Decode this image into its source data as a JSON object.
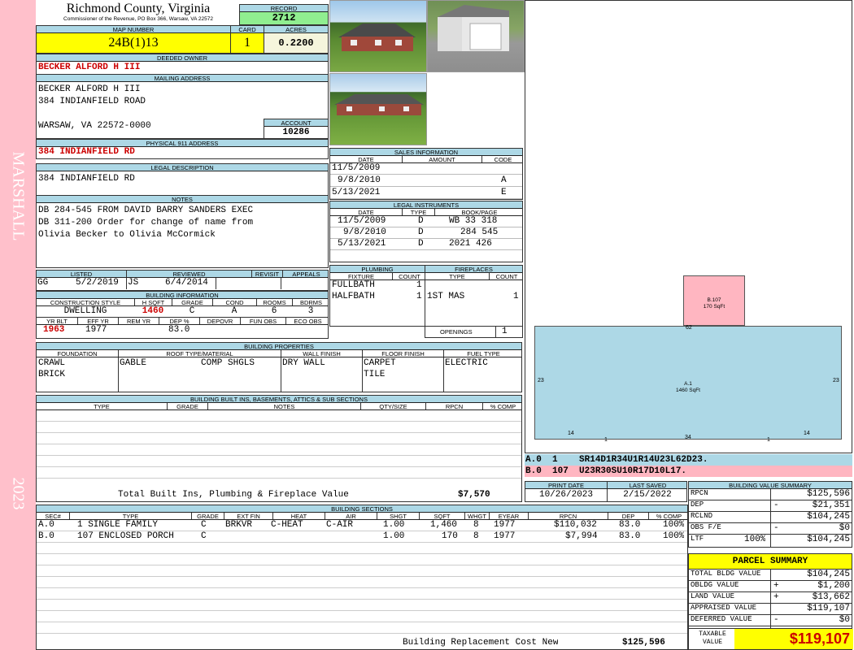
{
  "sidebar": {
    "district": "MARSHALL",
    "year": "2023"
  },
  "header": {
    "county": "Richmond County, Virginia",
    "commissioner": "Commissioner of the Revenue, PO Box 366, Warsaw, VA 22572",
    "record_label": "RECORD",
    "record": "2712",
    "map_label": "MAP NUMBER",
    "map_number": "24B(1)13",
    "card_label": "CARD",
    "card": "1",
    "acres_label": "ACRES",
    "acres": "0.2200"
  },
  "owner": {
    "deeded_label": "DEEDED OWNER",
    "deeded": "BECKER ALFORD H III",
    "mailing_label": "MAILING ADDRESS",
    "mailing_lines": [
      "BECKER ALFORD H III",
      "384 INDIANFIELD ROAD",
      "",
      "WARSAW, VA 22572-0000"
    ],
    "account_label": "ACCOUNT",
    "account": "10286",
    "physical_label": "PHYSICAL 911 ADDRESS",
    "physical": "384 INDIANFIELD RD",
    "legal_label": "LEGAL DESCRIPTION",
    "legal": "384 INDIANFIELD RD",
    "notes_label": "NOTES",
    "notes": [
      "DB 284-545 FROM DAVID BARRY SANDERS EXEC",
      "DB 311-200 Order for change of name from",
      "Olivia Becker to Olivia McCormick"
    ]
  },
  "sales": {
    "title": "SALES INFORMATION",
    "cols": [
      "DATE",
      "AMOUNT",
      "CODE"
    ],
    "rows": [
      [
        "11/5/2009",
        "",
        ""
      ],
      [
        "9/8/2010",
        "",
        "A"
      ],
      [
        "5/13/2021",
        "",
        "E"
      ]
    ]
  },
  "instruments": {
    "title": "LEGAL INSTRUMENTS",
    "cols": [
      "DATE",
      "TYPE",
      "BOOK/PAGE"
    ],
    "rows": [
      [
        "11/5/2009",
        "D",
        "WB 33 318"
      ],
      [
        "9/8/2010",
        "D",
        "284 545"
      ],
      [
        "5/13/2021",
        "D",
        "2021 426"
      ]
    ]
  },
  "listing": {
    "cols": [
      "LISTED",
      "REVIEWED",
      "REVISIT",
      "APPEALS"
    ],
    "listed_by": "GG",
    "listed_date": "5/2/2019",
    "reviewed_by": "JS",
    "reviewed_date": "6/4/2014"
  },
  "building_info": {
    "title": "BUILDING INFORMATION",
    "cols1": [
      "CONSTRUCTION STYLE",
      "H SQFT",
      "GRADE",
      "COND",
      "ROOMS",
      "BDRMS"
    ],
    "vals1": [
      "DWELLING",
      "1460",
      "C",
      "A",
      "6",
      "3"
    ],
    "cols2": [
      "YR BLT",
      "EFF YR",
      "REM YR",
      "DEP %",
      "DEPOVR",
      "FUN OBS",
      "ECO OBS"
    ],
    "vals2": [
      "1963",
      "1977",
      "",
      "83.0",
      "",
      "",
      ""
    ]
  },
  "plumbing": {
    "title": "PLUMBING",
    "cols": [
      "FIXTURE",
      "COUNT"
    ],
    "rows": [
      [
        "FULLBATH",
        "1"
      ],
      [
        "HALFBATH",
        "1"
      ]
    ]
  },
  "fireplaces": {
    "title": "FIREPLACES",
    "cols": [
      "TYPE",
      "COUNT"
    ],
    "rows": [
      [
        "1ST MAS",
        "1"
      ]
    ],
    "openings_label": "OPENINGS",
    "openings": "1"
  },
  "properties": {
    "title": "BUILDING PROPERTIES",
    "cols": [
      "FOUNDATION",
      "ROOF TYPE/MATERIAL",
      "WALL FINISH",
      "FLOOR FINISH",
      "FUEL TYPE"
    ],
    "foundation": [
      "CRAWL",
      "BRICK"
    ],
    "roof1": "GABLE",
    "roof2": "COMP SHGLS",
    "wall": "DRY WALL",
    "floor": [
      "CARPET",
      "TILE"
    ],
    "fuel": "ELECTRIC"
  },
  "builtins": {
    "title": "BUILDING BUILT INS, BASEMENTS, ATTICS & SUB SECTIONS",
    "cols": [
      "TYPE",
      "GRADE",
      "NOTES",
      "QTY/SIZE",
      "RPCN",
      "% COMP"
    ],
    "total_label": "Total Built Ins, Plumbing & Fireplace Value",
    "total": "$7,570"
  },
  "sections": {
    "title": "BUILDING SECTIONS",
    "cols": [
      "SEC#",
      "TYPE",
      "GRADE",
      "EXT FIN",
      "HEAT",
      "AIR",
      "SHGT",
      "SQFT",
      "WHGT",
      "EYEAR",
      "RPCN",
      "DEP",
      "% COMP"
    ],
    "rows": [
      [
        "A.0",
        "1 SINGLE FAMILY",
        "C",
        "BRKVR",
        "C-HEAT",
        "C-AIR",
        "1.00",
        "1,460",
        "8",
        "1977",
        "$110,032",
        "83.0",
        "100%"
      ],
      [
        "B.0",
        "107 ENCLOSED PORCH",
        "C",
        "",
        "",
        "",
        "1.00",
        "170",
        "8",
        "1977",
        "$7,994",
        "83.0",
        "100%"
      ]
    ],
    "replacement_label": "Building Replacement Cost New",
    "replacement": "$125,596"
  },
  "sketch": {
    "b_label": "B.107",
    "b_area": "170 SqFt",
    "a_label": "A.1",
    "a_area": "1460 SqFt",
    "dims": [
      "62",
      "23",
      "23",
      "14",
      "34",
      "14",
      "1",
      "1"
    ],
    "legend_a": "A.0  1    SR14D1R34U1R14U23L62D23.",
    "legend_b": "B.0  107  U23R30SU10R17D10L17."
  },
  "dates": {
    "print_label": "PRINT DATE",
    "print": "10/26/2023",
    "saved_label": "LAST SAVED",
    "saved": "2/15/2022"
  },
  "value_summary": {
    "title": "BUILDING VALUE SUMMARY",
    "rows": [
      {
        "label": "RPCN",
        "sign": "",
        "value": "$125,596"
      },
      {
        "label": "DEP",
        "sign": "-",
        "value": "$21,351"
      },
      {
        "label": "RCLND",
        "sign": "",
        "value": "$104,245"
      },
      {
        "label": "OBS F/E",
        "sign": "-",
        "value": "$0"
      },
      {
        "label": "LTF",
        "pct": "100%",
        "sign": "",
        "value": "$104,245"
      }
    ]
  },
  "parcel": {
    "title": "PARCEL SUMMARY",
    "rows": [
      {
        "label": "TOTAL BLDG VALUE",
        "sign": "",
        "value": "$104,245"
      },
      {
        "label": "OBLDG VALUE",
        "sign": "+",
        "value": "$1,200"
      },
      {
        "label": "LAND VALUE",
        "sign": "+",
        "value": "$13,662"
      },
      {
        "label": "APPRAISED VALUE",
        "sign": "",
        "value": "$119,107"
      },
      {
        "label": "DEFERRED VALUE",
        "sign": "-",
        "value": "$0"
      }
    ],
    "taxable_label": "TAXABLE VALUE",
    "taxable": "$119,107"
  },
  "colors": {
    "header_blue": "#add8e6",
    "highlight_yellow": "#ffff00",
    "record_green": "#90ee90",
    "sidebar_pink": "#ffc0cb",
    "value_red": "#cc0000"
  }
}
